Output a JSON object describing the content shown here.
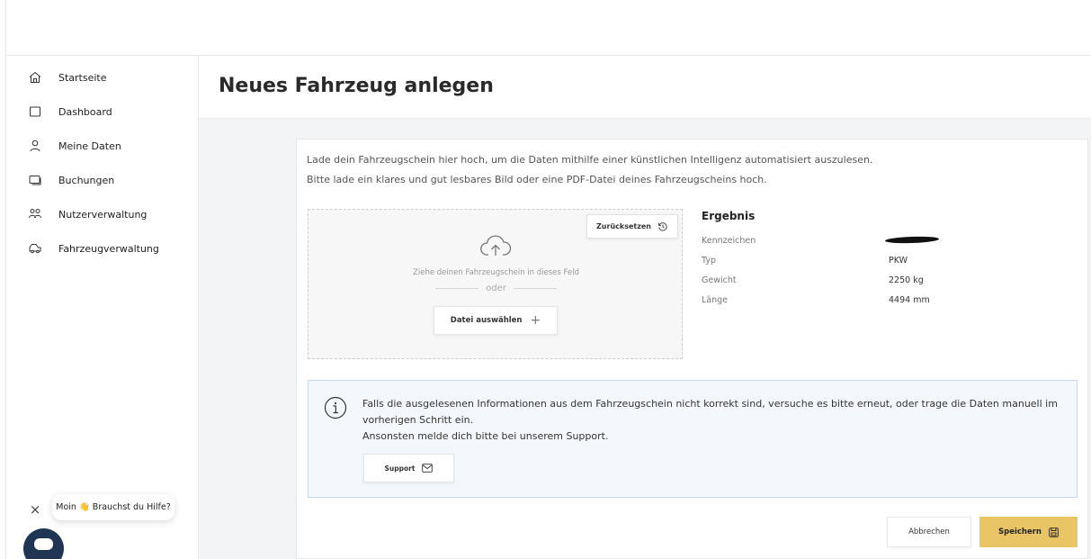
{
  "sidebar": {
    "items": [
      {
        "label": "Startseite",
        "icon": "home-icon"
      },
      {
        "label": "Dashboard",
        "icon": "dashboard-icon"
      },
      {
        "label": "Meine Daten",
        "icon": "user-icon"
      },
      {
        "label": "Buchungen",
        "icon": "bookings-icon"
      },
      {
        "label": "Nutzerverwaltung",
        "icon": "users-icon"
      },
      {
        "label": "Fahrzeugverwaltung",
        "icon": "car-icon"
      }
    ]
  },
  "page": {
    "title": "Neues Fahrzeug anlegen"
  },
  "upload": {
    "intro_line1": "Lade dein Fahrzeugschein hier hoch, um die Daten mithilfe einer künstlichen Intelligenz automatisiert auszulesen.",
    "intro_line2": "Bitte lade ein klares und gut lesbares Bild oder eine PDF-Datei deines Fahrzeugscheins hoch.",
    "reset_label": "Zurücksetzen",
    "drop_hint": "Ziehe deinen Fahrzeugschein in dieses Feld",
    "or_label": "oder",
    "choose_file_label": "Datei auswählen",
    "plus_glyph": "+"
  },
  "result": {
    "title": "Ergebnis",
    "rows": [
      {
        "label": "Kennzeichen",
        "value": ""
      },
      {
        "label": "Typ",
        "value": "PKW"
      },
      {
        "label": "Gewicht",
        "value": "2250 kg"
      },
      {
        "label": "Länge",
        "value": "4494 mm"
      }
    ]
  },
  "info": {
    "line1": "Falls die ausgelesenen Informationen aus dem Fahrzeugschein nicht korrekt sind, versuche es bitte erneut, oder trage die Daten manuell im",
    "line2": "vorherigen Schritt ein.",
    "line3": "Ansonsten melde dich bitte bei unserem Support.",
    "support_label": "Support"
  },
  "actions": {
    "cancel_label": "Abbrechen",
    "save_label": "Speichern"
  },
  "chat": {
    "greeting": "Moin 👋 Brauchst du Hilfe?",
    "close_glyph": "×"
  },
  "colors": {
    "accent": "#e9c566",
    "info_bg": "#f4f8fc",
    "info_border": "#c5d8ec",
    "chat": "#1f3553"
  }
}
